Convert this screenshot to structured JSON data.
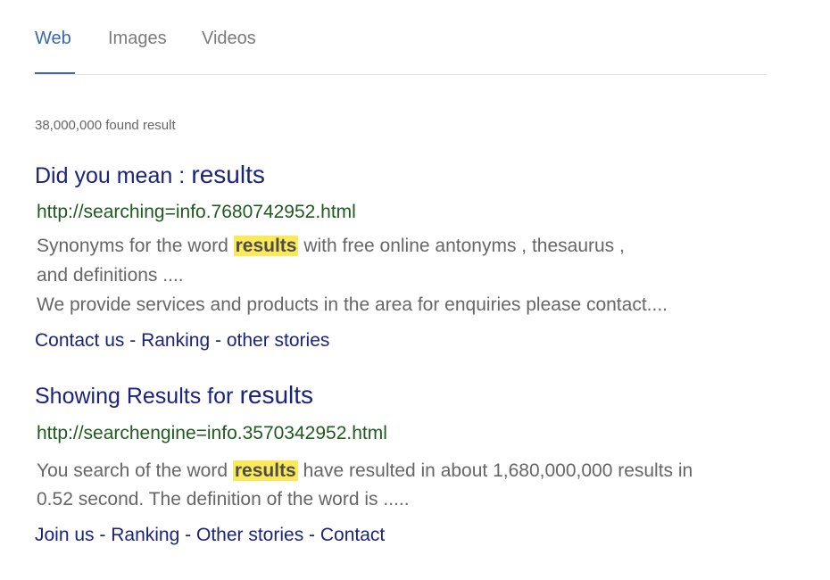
{
  "tabs": [
    {
      "label": "Web",
      "active": true
    },
    {
      "label": "Images",
      "active": false
    },
    {
      "label": "Videos",
      "active": false
    }
  ],
  "result_count": "38,000,000 found result",
  "results": [
    {
      "title_prefix": "Did you mean :",
      "title_query": "results",
      "url": "http://searching=info.7680742952.html",
      "snippet_line1_before": "Synonyms for the word",
      "snippet_highlight": "results",
      "snippet_line1_after": "with free online antonyms , thesaurus ,",
      "snippet_line2": "and definitions ....",
      "snippet_line3": "We provide services and products in the area for enquiries please contact....",
      "links": [
        "Contact us",
        "Ranking",
        "other stories"
      ],
      "separator": "-"
    },
    {
      "title_prefix": "Showing Results for",
      "title_query": "results",
      "url": "http://searchengine=info.3570342952.html",
      "snippet_line1_before": "You search of the word",
      "snippet_highlight": "results",
      "snippet_line1_after": "have resulted in about 1,680,000,000 results in",
      "snippet_line2": "0.52 second. The definition of the word is .....",
      "links": [
        "Join us",
        "Ranking",
        "Other stories",
        "Contact"
      ],
      "separator": "-"
    }
  ],
  "colors": {
    "accent": "#3568b5",
    "title": "#1a237e",
    "url": "#1e5a1e",
    "snippet": "#666666",
    "highlight": "#fbe95a"
  }
}
